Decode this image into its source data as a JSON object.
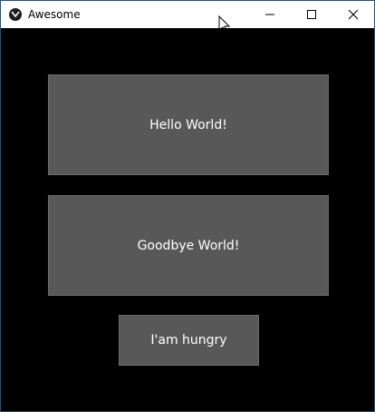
{
  "window": {
    "title": "Awesome",
    "app_icon": "kivy-logo-icon",
    "controls": [
      "minimize-icon",
      "maximize-icon",
      "close-icon"
    ]
  },
  "buttons": {
    "hello": "Hello World!",
    "goodbye": "Goodbye World!",
    "hungry": "I'am hungry"
  },
  "colors": {
    "background": "#000000",
    "button": "#585858",
    "button_text": "#ffffff"
  }
}
